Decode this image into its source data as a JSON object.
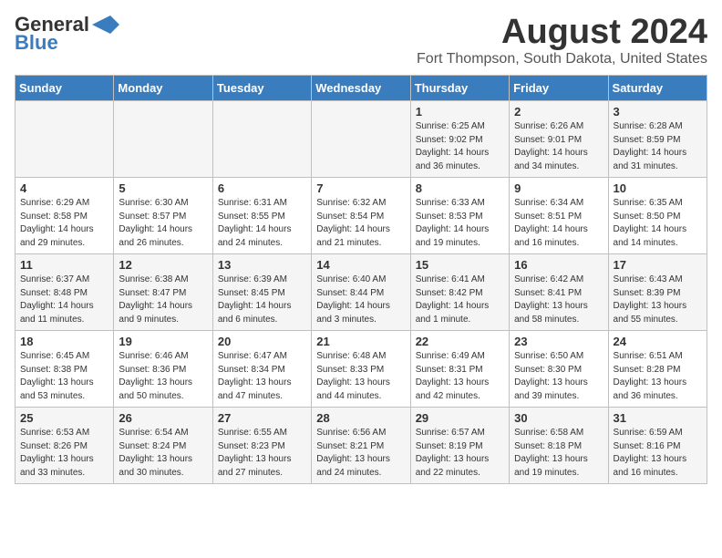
{
  "logo": {
    "line1": "General",
    "line2": "Blue"
  },
  "title": "August 2024",
  "location": "Fort Thompson, South Dakota, United States",
  "days_of_week": [
    "Sunday",
    "Monday",
    "Tuesday",
    "Wednesday",
    "Thursday",
    "Friday",
    "Saturday"
  ],
  "weeks": [
    [
      {
        "num": "",
        "info": ""
      },
      {
        "num": "",
        "info": ""
      },
      {
        "num": "",
        "info": ""
      },
      {
        "num": "",
        "info": ""
      },
      {
        "num": "1",
        "info": "Sunrise: 6:25 AM\nSunset: 9:02 PM\nDaylight: 14 hours\nand 36 minutes."
      },
      {
        "num": "2",
        "info": "Sunrise: 6:26 AM\nSunset: 9:01 PM\nDaylight: 14 hours\nand 34 minutes."
      },
      {
        "num": "3",
        "info": "Sunrise: 6:28 AM\nSunset: 8:59 PM\nDaylight: 14 hours\nand 31 minutes."
      }
    ],
    [
      {
        "num": "4",
        "info": "Sunrise: 6:29 AM\nSunset: 8:58 PM\nDaylight: 14 hours\nand 29 minutes."
      },
      {
        "num": "5",
        "info": "Sunrise: 6:30 AM\nSunset: 8:57 PM\nDaylight: 14 hours\nand 26 minutes."
      },
      {
        "num": "6",
        "info": "Sunrise: 6:31 AM\nSunset: 8:55 PM\nDaylight: 14 hours\nand 24 minutes."
      },
      {
        "num": "7",
        "info": "Sunrise: 6:32 AM\nSunset: 8:54 PM\nDaylight: 14 hours\nand 21 minutes."
      },
      {
        "num": "8",
        "info": "Sunrise: 6:33 AM\nSunset: 8:53 PM\nDaylight: 14 hours\nand 19 minutes."
      },
      {
        "num": "9",
        "info": "Sunrise: 6:34 AM\nSunset: 8:51 PM\nDaylight: 14 hours\nand 16 minutes."
      },
      {
        "num": "10",
        "info": "Sunrise: 6:35 AM\nSunset: 8:50 PM\nDaylight: 14 hours\nand 14 minutes."
      }
    ],
    [
      {
        "num": "11",
        "info": "Sunrise: 6:37 AM\nSunset: 8:48 PM\nDaylight: 14 hours\nand 11 minutes."
      },
      {
        "num": "12",
        "info": "Sunrise: 6:38 AM\nSunset: 8:47 PM\nDaylight: 14 hours\nand 9 minutes."
      },
      {
        "num": "13",
        "info": "Sunrise: 6:39 AM\nSunset: 8:45 PM\nDaylight: 14 hours\nand 6 minutes."
      },
      {
        "num": "14",
        "info": "Sunrise: 6:40 AM\nSunset: 8:44 PM\nDaylight: 14 hours\nand 3 minutes."
      },
      {
        "num": "15",
        "info": "Sunrise: 6:41 AM\nSunset: 8:42 PM\nDaylight: 14 hours\nand 1 minute."
      },
      {
        "num": "16",
        "info": "Sunrise: 6:42 AM\nSunset: 8:41 PM\nDaylight: 13 hours\nand 58 minutes."
      },
      {
        "num": "17",
        "info": "Sunrise: 6:43 AM\nSunset: 8:39 PM\nDaylight: 13 hours\nand 55 minutes."
      }
    ],
    [
      {
        "num": "18",
        "info": "Sunrise: 6:45 AM\nSunset: 8:38 PM\nDaylight: 13 hours\nand 53 minutes."
      },
      {
        "num": "19",
        "info": "Sunrise: 6:46 AM\nSunset: 8:36 PM\nDaylight: 13 hours\nand 50 minutes."
      },
      {
        "num": "20",
        "info": "Sunrise: 6:47 AM\nSunset: 8:34 PM\nDaylight: 13 hours\nand 47 minutes."
      },
      {
        "num": "21",
        "info": "Sunrise: 6:48 AM\nSunset: 8:33 PM\nDaylight: 13 hours\nand 44 minutes."
      },
      {
        "num": "22",
        "info": "Sunrise: 6:49 AM\nSunset: 8:31 PM\nDaylight: 13 hours\nand 42 minutes."
      },
      {
        "num": "23",
        "info": "Sunrise: 6:50 AM\nSunset: 8:30 PM\nDaylight: 13 hours\nand 39 minutes."
      },
      {
        "num": "24",
        "info": "Sunrise: 6:51 AM\nSunset: 8:28 PM\nDaylight: 13 hours\nand 36 minutes."
      }
    ],
    [
      {
        "num": "25",
        "info": "Sunrise: 6:53 AM\nSunset: 8:26 PM\nDaylight: 13 hours\nand 33 minutes."
      },
      {
        "num": "26",
        "info": "Sunrise: 6:54 AM\nSunset: 8:24 PM\nDaylight: 13 hours\nand 30 minutes."
      },
      {
        "num": "27",
        "info": "Sunrise: 6:55 AM\nSunset: 8:23 PM\nDaylight: 13 hours\nand 27 minutes."
      },
      {
        "num": "28",
        "info": "Sunrise: 6:56 AM\nSunset: 8:21 PM\nDaylight: 13 hours\nand 24 minutes."
      },
      {
        "num": "29",
        "info": "Sunrise: 6:57 AM\nSunset: 8:19 PM\nDaylight: 13 hours\nand 22 minutes."
      },
      {
        "num": "30",
        "info": "Sunrise: 6:58 AM\nSunset: 8:18 PM\nDaylight: 13 hours\nand 19 minutes."
      },
      {
        "num": "31",
        "info": "Sunrise: 6:59 AM\nSunset: 8:16 PM\nDaylight: 13 hours\nand 16 minutes."
      }
    ]
  ]
}
